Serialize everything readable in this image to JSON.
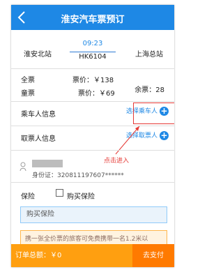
{
  "header": {
    "title": "淮安汽车票预订"
  },
  "trip": {
    "from": "淮安北站",
    "to": "上海总站",
    "time": "09:23",
    "train": "HK6104"
  },
  "fares": {
    "full_label": "全票",
    "full_price": "票价：￥138",
    "child_label": "童票",
    "child_price": "票价：￥69",
    "remaining": "余票：28"
  },
  "passenger": {
    "label": "乘车人信息",
    "select": "选择乘车人"
  },
  "ticket_taker": {
    "label": "取票人信息",
    "select": "选择取票人"
  },
  "annotation": {
    "text": "点击进入"
  },
  "person": {
    "id_label": "身份证：",
    "id_value": "320811197607******"
  },
  "insurance": {
    "label": "保险",
    "checkbox_label": "购买保险",
    "buy_placeholder": "购买保险"
  },
  "notice": {
    "text": "携一张全价票的旅客可免费携带一名1.2米以"
  },
  "footer": {
    "total": "订单总额：￥0",
    "pay": "去支付"
  },
  "colors": {
    "header_blue": "#1e88e5",
    "accent_red": "#e53935",
    "footer_orange": "#ff9f10",
    "pay_orange": "#ff7a00"
  },
  "icons": [
    "chevron-left-icon",
    "plus-circle-icon",
    "person-icon"
  ]
}
